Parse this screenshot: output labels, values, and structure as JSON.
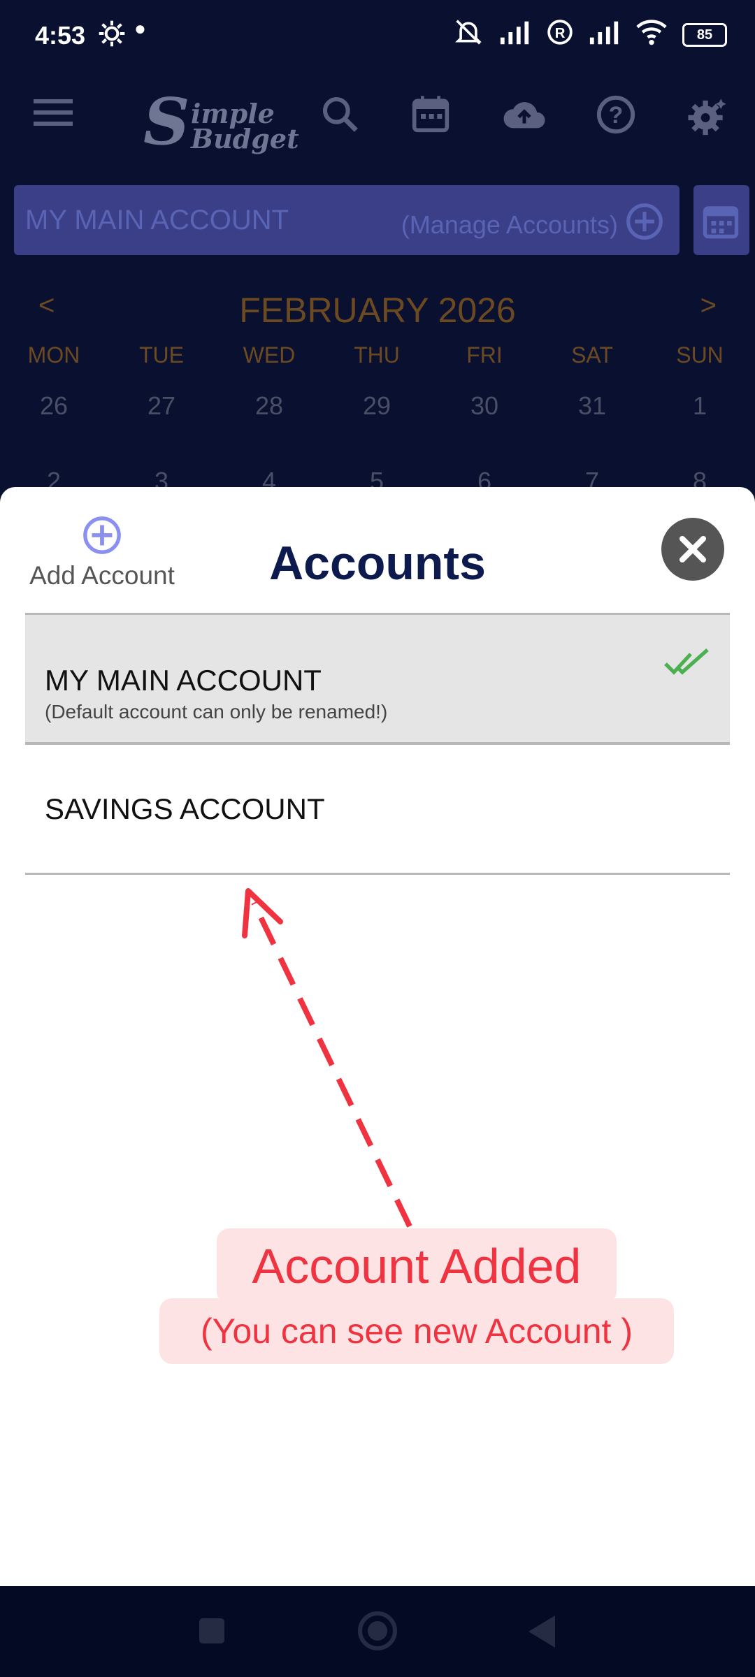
{
  "status_bar": {
    "time": "4:53",
    "battery": "85"
  },
  "app": {
    "logo_big": "S",
    "logo_line1": "imple",
    "logo_line2": "Budget"
  },
  "account_bar": {
    "name": "MY MAIN ACCOUNT",
    "manage_label": "(Manage Accounts)"
  },
  "calendar": {
    "prev": "<",
    "next": ">",
    "month": "FEBRUARY 2026",
    "weekdays": [
      "MON",
      "TUE",
      "WED",
      "THU",
      "FRI",
      "SAT",
      "SUN"
    ],
    "week1": [
      "26",
      "27",
      "28",
      "29",
      "30",
      "31",
      "1"
    ],
    "week2": [
      "2",
      "3",
      "4",
      "5",
      "6",
      "7",
      "8"
    ]
  },
  "sheet": {
    "add_label": "Add Account",
    "title": "Accounts",
    "accounts": [
      {
        "name": "MY MAIN ACCOUNT",
        "note": "(Default account can only be renamed!)",
        "selected": true
      },
      {
        "name": "SAVINGS ACCOUNT",
        "note": "",
        "selected": false
      }
    ]
  },
  "annotation": {
    "headline": "Account Added",
    "detail": "(You can see new Account )"
  },
  "colors": {
    "accent": "#8b8ff0",
    "title": "#0d1a4d",
    "check": "#4caf50",
    "callout": "#ef3340",
    "callout_bg": "#fde3e3"
  }
}
